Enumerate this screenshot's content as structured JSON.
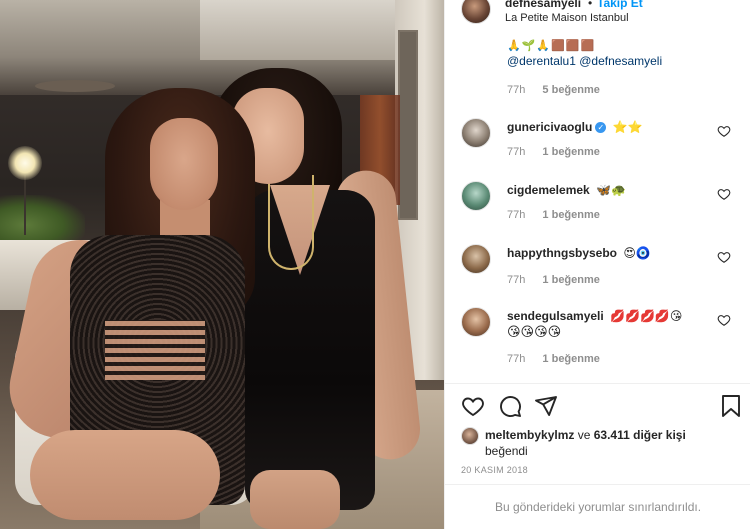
{
  "header": {
    "username": "defnesamyeli",
    "separator": "•",
    "follow_label": "Takip Et",
    "location": "La Petite Maison Istanbul"
  },
  "caption": {
    "emoji_line": "🙏🌱🙏🟫🟫🟫",
    "mentions": [
      "@derentalu1",
      "@defnesamyeli"
    ],
    "time": "77h",
    "likes": "5 beğenme"
  },
  "comments": [
    {
      "user": "gunericivaoglu",
      "verified": true,
      "text": "⭐⭐",
      "text2": "",
      "time": "77h",
      "likes": "1 beğenme"
    },
    {
      "user": "cigdemelemek",
      "verified": false,
      "text": "🦋🐢",
      "text2": "",
      "time": "77h",
      "likes": "1 beğenme"
    },
    {
      "user": "happythngsbysebo",
      "verified": false,
      "text": "😍🧿",
      "text2": "",
      "time": "77h",
      "likes": "1 beğenme"
    },
    {
      "user": "sendegulsamyeli",
      "verified": false,
      "text": "💋💋💋💋😘",
      "text2": "😘😘😘😘",
      "time": "77h",
      "likes": "1 beğenme"
    }
  ],
  "liked_by": {
    "user": "meltembykylmz",
    "middle": "ve",
    "others": "63.411 diğer kişi",
    "suffix": "beğendi"
  },
  "date": "20 KASIM 2018",
  "comments_limited": "Bu gönderideki yorumlar sınırlandırıldı.",
  "icons": [
    "heart-icon",
    "comment-icon",
    "share-icon",
    "bookmark-icon"
  ],
  "colors": {
    "link": "#0095f6",
    "mention": "#00376b",
    "muted": "#8e8e8e",
    "verified": "#3897f0"
  }
}
